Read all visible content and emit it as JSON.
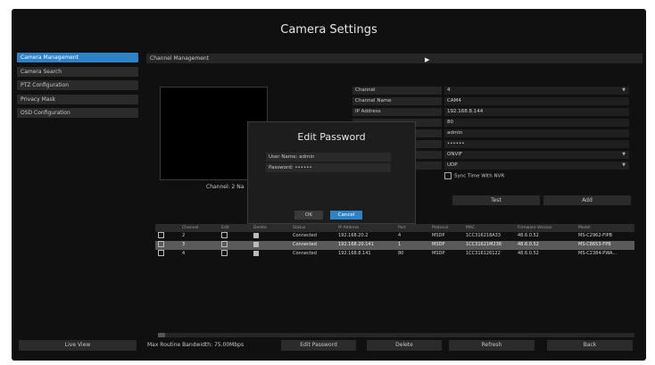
{
  "window": {
    "title": "Camera Settings"
  },
  "sidebar": {
    "items": [
      {
        "label": "Camera Management",
        "active": true
      },
      {
        "label": "Camera Search"
      },
      {
        "label": "PTZ Configuration"
      },
      {
        "label": "Privacy Mask"
      },
      {
        "label": "OSD Configuration"
      }
    ],
    "live_view": "Live View"
  },
  "section": {
    "header": "Channel Management"
  },
  "preview": {
    "caption": "Channel: 2 Na"
  },
  "properties": [
    {
      "label": "Channel",
      "value": "4",
      "dropdown": true
    },
    {
      "label": "Channel Name",
      "value": "CAM4"
    },
    {
      "label": "IP Address",
      "value": "192.168.8.144"
    },
    {
      "label": "",
      "value": "80"
    },
    {
      "label": "",
      "value": "admin"
    },
    {
      "label": "",
      "value": "••••••"
    },
    {
      "label": "",
      "value": "ONVIF",
      "dropdown": true
    },
    {
      "label": "",
      "value": "UDP",
      "dropdown": true
    }
  ],
  "sync": {
    "label": "Sync Time With NVR",
    "checked": false
  },
  "buttons": {
    "test": "Test",
    "add": "Add"
  },
  "table": {
    "headers": [
      "",
      "Channel",
      "Edit",
      "Delete",
      "Status",
      "IP Address",
      "Port",
      "Protocol",
      "MAC",
      "Firmware Version",
      "Model"
    ],
    "rows": [
      [
        "",
        "2",
        "",
        "",
        "Connected",
        "192.168.20.2",
        "4",
        "MSDP",
        "1CC316218A33",
        "48.6.0.52",
        "MS-C2962-FIPB"
      ],
      [
        "",
        "3",
        "",
        "",
        "Connected",
        "192.168.20.141",
        "1",
        "MSDP",
        "1CC31621M238",
        "48.6.0.52",
        "MS-C8653-FPB"
      ],
      [
        "",
        "4",
        "",
        "",
        "Connected",
        "192.168.8.141",
        "80",
        "MSDP",
        "1CC316126122",
        "48.6.0.52",
        "MS-C2384-PWA..."
      ]
    ],
    "selected_row": 1
  },
  "footer": {
    "bandwidth": "Max Routine Bandwidth: 75.00Mbps",
    "edit_password": "Edit Password",
    "delete": "Delete",
    "refresh": "Refresh",
    "back": "Back"
  },
  "dialog": {
    "title": "Edit Password",
    "user_label": "User Name:",
    "user_value": "admin",
    "password_label": "Password:",
    "password_value": "••••••",
    "ok": "OK",
    "cancel": "Cancel"
  },
  "colors": {
    "accent": "#2d82c8",
    "background": "#101010",
    "panel": "#262626"
  }
}
